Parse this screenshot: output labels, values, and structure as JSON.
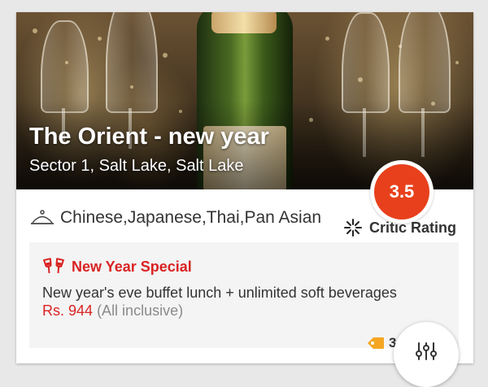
{
  "restaurant": {
    "name": "The Orient - new year",
    "address": "Sector 1, Salt Lake, Salt Lake",
    "rating": "3.5",
    "cuisines": "Chinese,Japanese,Thai,Pan Asian",
    "critic_label": "Critic Rating"
  },
  "offer": {
    "title": "New Year Special",
    "description": "New year's eve buffet lunch + unlimited soft beverages",
    "price": "Rs. 944",
    "price_note": "(All inclusive)",
    "tag_count": "3"
  },
  "colors": {
    "accent": "#e8401c",
    "offer_red": "#d92323",
    "tag_orange": "#f5a623"
  },
  "icons": {
    "cuisine": "cloche-icon",
    "critic": "starburst-icon",
    "offer": "cheers-icon",
    "tag": "tag-icon",
    "fab": "filter-sliders-icon"
  }
}
